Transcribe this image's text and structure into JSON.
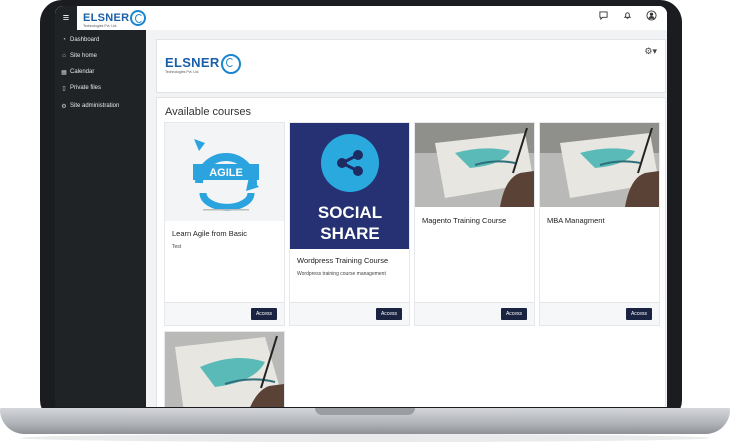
{
  "topbar": {
    "menu_icon": "hamburger-icon",
    "logo_text": "ELSNER",
    "logo_subtext": "Technologies Pvt. Ltd.",
    "icons": [
      "chat-icon",
      "bell-icon",
      "user-avatar-icon"
    ]
  },
  "sidebar": {
    "items": [
      {
        "label": "Dashboard",
        "icon": "dashboard-icon"
      },
      {
        "label": "Site home",
        "icon": "home-icon"
      },
      {
        "label": "Calendar",
        "icon": "calendar-icon"
      },
      {
        "label": "Private files",
        "icon": "file-icon"
      },
      {
        "label": "Site administration",
        "icon": "settings-icon"
      }
    ]
  },
  "header": {
    "logo_text": "ELSNER",
    "logo_subtext": "Technologies Pvt. Ltd.",
    "settings_icon": "gear-icon"
  },
  "main": {
    "title": "Available courses",
    "courses": [
      {
        "name": "Learn Agile from Basic",
        "summary": "Test",
        "image_text": "AGILE",
        "button": "Access"
      },
      {
        "name": "Wordpress Training Course",
        "summary": "Wordpress training course management",
        "image_text_1": "SOCIAL",
        "image_text_2": "SHARE",
        "button": "Access"
      },
      {
        "name": "Magento Training Course",
        "summary": "",
        "button": "Access"
      },
      {
        "name": "MBA Managment",
        "summary": "",
        "button": "Access"
      }
    ]
  },
  "colors": {
    "sidebar": "#1f2326",
    "brand": "#1a5fa8",
    "button": "#1b2342",
    "social_bg": "#253172"
  }
}
